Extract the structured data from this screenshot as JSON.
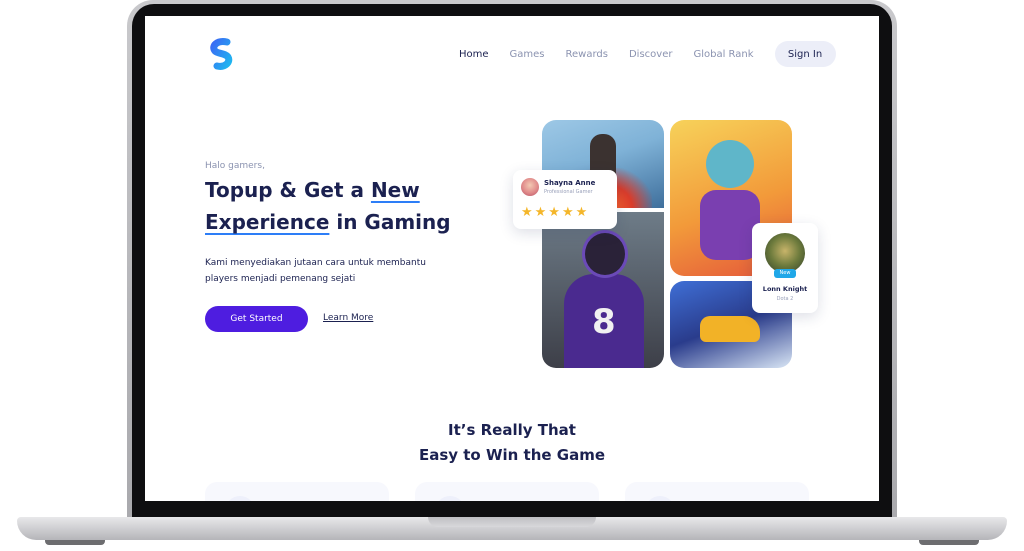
{
  "nav": {
    "links": [
      "Home",
      "Games",
      "Rewards",
      "Discover",
      "Global Rank"
    ],
    "signin_label": "Sign In"
  },
  "hero": {
    "greeting": "Halo gamers,",
    "title_part1": "Topup & Get a ",
    "title_highlight1": "New",
    "title_highlight2": "Experience",
    "title_part2": " in Gaming",
    "description": "Kami menyediakan jutaan cara untuk membantu players menjadi pemenang sejati",
    "primary_button": "Get Started",
    "secondary_link": "Learn More"
  },
  "gamer_card": {
    "name": "Shayna Anne",
    "role": "Professional Gamer",
    "stars": "★★★★★",
    "rating": 5
  },
  "player_card": {
    "badge": "New",
    "name": "Lonn Knight",
    "game": "Dota 2"
  },
  "jersey_number": "8",
  "section": {
    "title_line1": "It’s Really That",
    "title_line2": "Easy to Win the Game"
  },
  "colors": {
    "primary": "#4e1de0",
    "text_dark": "#1b2150",
    "text_muted": "#8b93b0",
    "star": "#f4b62a",
    "badge": "#1fa7e8"
  }
}
